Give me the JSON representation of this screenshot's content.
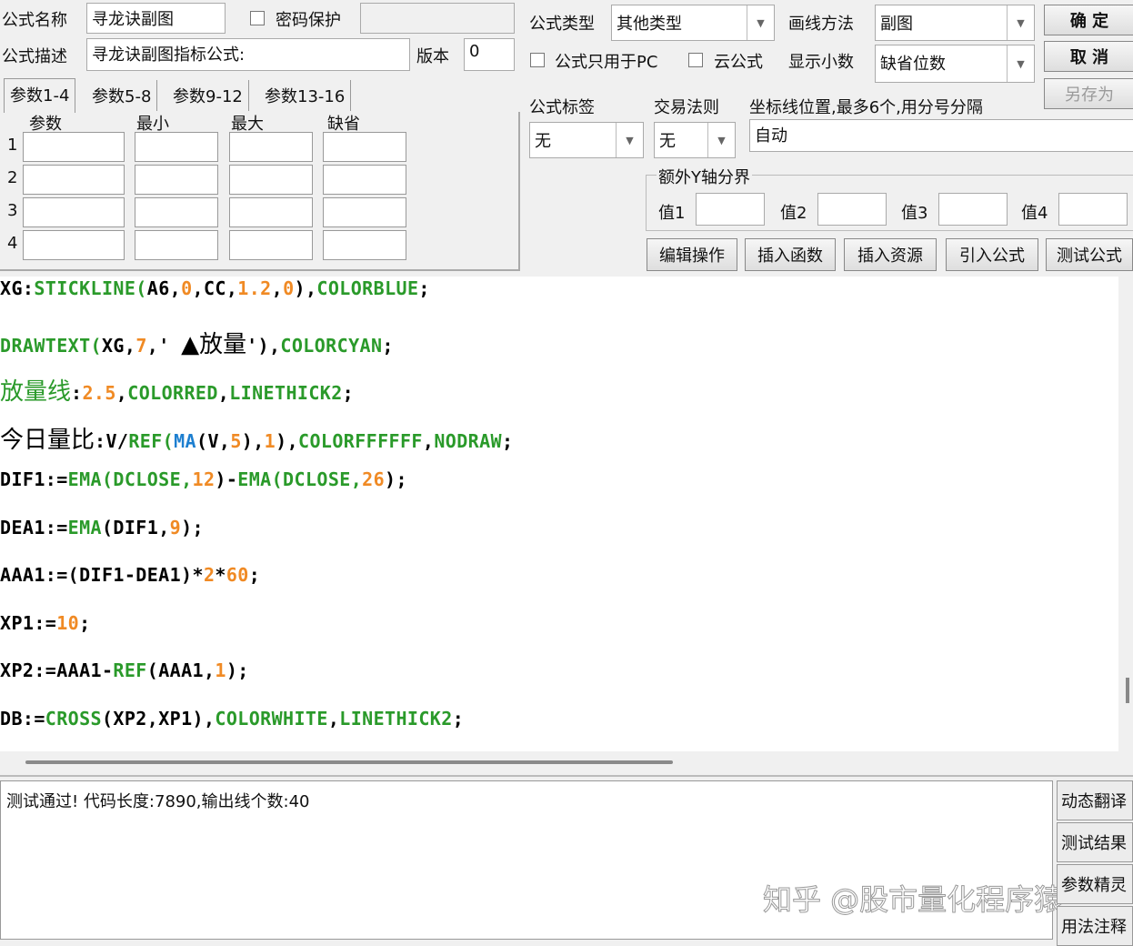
{
  "header": {
    "name_label": "公式名称",
    "name_value": "寻龙诀副图",
    "password_label": "密码保护",
    "desc_label": "公式描述",
    "desc_value": "寻龙诀副图指标公式:",
    "version_label": "版本",
    "version_value": "0",
    "type_label": "公式类型",
    "type_value": "其他类型",
    "draw_label": "画线方法",
    "draw_value": "副图",
    "pc_only_label": "公式只用于PC",
    "cloud_label": "云公式",
    "decimal_label": "显示小数",
    "decimal_value": "缺省位数"
  },
  "buttons": {
    "ok": "确 定",
    "cancel": "取 消",
    "save_as": "另存为"
  },
  "tabs": [
    "参数1-4",
    "参数5-8",
    "参数9-12",
    "参数13-16"
  ],
  "params": {
    "headers": [
      "参数",
      "最小",
      "最大",
      "缺省"
    ],
    "rows": [
      "1",
      "2",
      "3",
      "4"
    ]
  },
  "right": {
    "tag_label": "公式标签",
    "tag_value": "无",
    "rule_label": "交易法则",
    "rule_value": "无",
    "axis_label": "坐标线位置,最多6个,用分号分隔",
    "axis_value": "自动",
    "yaxis_group": "额外Y轴分界",
    "values": [
      "值1",
      "值2",
      "值3",
      "值4"
    ]
  },
  "actions": [
    "编辑操作",
    "插入函数",
    "插入资源",
    "引入公式",
    "测试公式"
  ],
  "code": [
    [
      [
        "XG:",
        "k"
      ],
      [
        "STICKLINE(",
        "f"
      ],
      [
        "A6,",
        "k"
      ],
      [
        "0",
        "n"
      ],
      [
        ",CC,",
        "k"
      ],
      [
        "1.2",
        "n"
      ],
      [
        ",",
        "k"
      ],
      [
        "0",
        "n"
      ],
      [
        "),",
        "k"
      ],
      [
        "COLORBLUE",
        "f"
      ],
      [
        ";",
        "k"
      ]
    ],
    [
      [
        "DRAWTEXT(",
        "f"
      ],
      [
        "XG,",
        "k"
      ],
      [
        "7",
        "n"
      ],
      [
        ",' ",
        "k"
      ],
      [
        "▲放量",
        "kc"
      ],
      [
        "'),",
        "k"
      ],
      [
        "COLORCYAN",
        "f"
      ],
      [
        ";",
        "k"
      ]
    ],
    [
      [
        "放量线",
        "fc"
      ],
      [
        ":",
        "k"
      ],
      [
        "2.5",
        "n"
      ],
      [
        ",",
        "k"
      ],
      [
        "COLORRED",
        "f"
      ],
      [
        ",",
        "k"
      ],
      [
        "LINETHICK2",
        "f"
      ],
      [
        ";",
        "k"
      ]
    ],
    [
      [
        "今日量比",
        "kc"
      ],
      [
        ":V/",
        "k"
      ],
      [
        "REF(",
        "f"
      ],
      [
        "MA",
        "b"
      ],
      [
        "(V,",
        "k"
      ],
      [
        "5",
        "n"
      ],
      [
        "),",
        "k"
      ],
      [
        "1",
        "n"
      ],
      [
        "),",
        "k"
      ],
      [
        "COLORFFFFFF",
        "f"
      ],
      [
        ",",
        "k"
      ],
      [
        "NODRAW",
        "f"
      ],
      [
        ";",
        "k"
      ]
    ],
    [
      [
        "DIF1:=",
        "k"
      ],
      [
        "EMA(DCLOSE,",
        "f"
      ],
      [
        "12",
        "n"
      ],
      [
        ")-",
        "k"
      ],
      [
        "EMA(DCLOSE,",
        "f"
      ],
      [
        "26",
        "n"
      ],
      [
        ");",
        "k"
      ]
    ],
    [
      [
        "DEA1:=",
        "k"
      ],
      [
        "EMA",
        "f"
      ],
      [
        "(DIF1,",
        "k"
      ],
      [
        "9",
        "n"
      ],
      [
        ");",
        "k"
      ]
    ],
    [
      [
        "AAA1:=(DIF1-DEA1)*",
        "k"
      ],
      [
        "2",
        "n"
      ],
      [
        "*",
        "k"
      ],
      [
        "60",
        "n"
      ],
      [
        ";",
        "k"
      ]
    ],
    [
      [
        "XP1:=",
        "k"
      ],
      [
        "10",
        "n"
      ],
      [
        ";",
        "k"
      ]
    ],
    [
      [
        "XP2:=AAA1-",
        "k"
      ],
      [
        "REF",
        "f"
      ],
      [
        "(AAA1,",
        "k"
      ],
      [
        "1",
        "n"
      ],
      [
        ");",
        "k"
      ]
    ],
    [
      [
        "DB:=",
        "k"
      ],
      [
        "CROSS",
        "f"
      ],
      [
        "(XP2,XP1),",
        "k"
      ],
      [
        "COLORWHITE",
        "f"
      ],
      [
        ",",
        "k"
      ],
      [
        "LINETHICK2",
        "f"
      ],
      [
        ";",
        "k"
      ]
    ]
  ],
  "output": {
    "message": "测试通过! 代码长度:7890,输出线个数:40",
    "watermark": "知乎 @股市量化程序猿"
  },
  "side_buttons": [
    "动态翻译",
    "测试结果",
    "参数精灵",
    "用法注释"
  ]
}
